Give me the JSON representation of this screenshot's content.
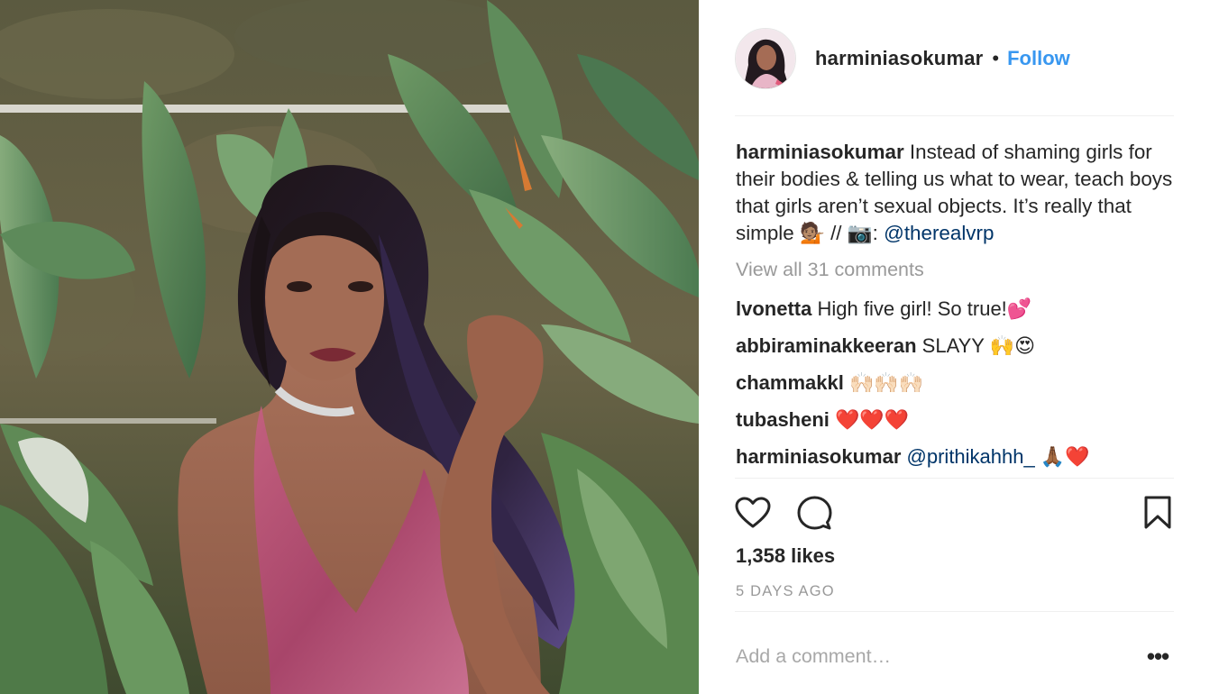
{
  "post": {
    "username": "harminiasokumar",
    "follow_label": "Follow",
    "header_separator": "•",
    "caption": {
      "username": "harminiasokumar",
      "text": "Instead of shaming girls for their bodies & telling us what to wear, teach boys that girls aren’t sexual objects. It’s really that simple",
      "emoji_1": "💁🏽",
      "separator": "//",
      "emoji_2": "📷",
      "colon": ":",
      "mention": "@therealvrp"
    },
    "view_all_comments": "View all 31 comments",
    "comments": [
      {
        "username": "lvonetta",
        "text": "High five girl! So true!",
        "emoji": "💕"
      },
      {
        "username": "abbiraminakkeeran",
        "text": "SLAYY",
        "emoji": "🙌😍"
      },
      {
        "username": "chammakkl",
        "text": "",
        "emoji": "🙌🏻🙌🏻🙌🏻"
      },
      {
        "username": "tubasheni",
        "text": "",
        "emoji": "❤️❤️❤️"
      },
      {
        "username": "harminiasokumar",
        "text": "",
        "mention": "@prithikahhh_",
        "emoji": "🙏🏾❤️"
      }
    ],
    "likes": "1,358 likes",
    "time_ago": "5 DAYS AGO",
    "add_comment_placeholder": "Add a comment…",
    "more_label": "•••"
  },
  "icons": {
    "like": "heart-icon",
    "comment": "speech-bubble-icon",
    "save": "bookmark-icon",
    "more": "more-options-icon"
  },
  "colors": {
    "follow_blue": "#3897f0",
    "mention_navy": "#003569",
    "muted_gray": "#999999",
    "text": "#262626"
  }
}
